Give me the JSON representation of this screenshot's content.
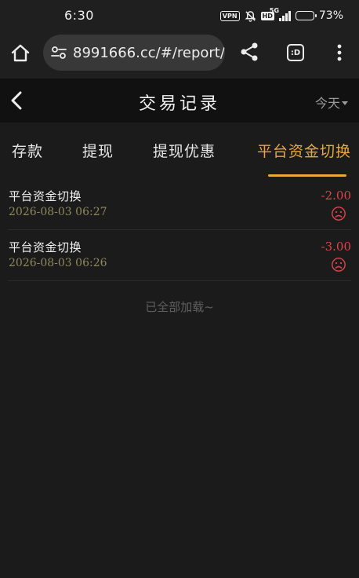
{
  "status_bar": {
    "time": "6:30",
    "vpn": "VPN",
    "hd": "HD",
    "network": "5G",
    "battery": "73%",
    "battery_level": 0.73
  },
  "browser": {
    "url": "8991666.cc/#/report/a",
    "tab_badge": ":D",
    "icons": [
      "home-icon",
      "tune-icon",
      "share-icon",
      "tab-icon",
      "more-vertical-icon"
    ]
  },
  "header": {
    "title": "交易记录",
    "date_filter": "今天"
  },
  "tabs": [
    {
      "label": "存款",
      "active": false
    },
    {
      "label": "提现",
      "active": false
    },
    {
      "label": "提现优惠",
      "active": false
    },
    {
      "label": "平台资金切换",
      "active": true
    }
  ],
  "records": [
    {
      "title": "平台资金切换",
      "time": "2026-08-03 06:27",
      "amount": "-2.00",
      "status_icon": "sad-face-icon"
    },
    {
      "title": "平台资金切换",
      "time": "2026-08-03 06:26",
      "amount": "-3.00",
      "status_icon": "sad-face-icon"
    }
  ],
  "load_status": "已全部加载~",
  "colors": {
    "accent": "#e8a93a",
    "negative": "#e0434a",
    "timestamp": "#8d8a5e",
    "background": "#1b1b1b"
  }
}
